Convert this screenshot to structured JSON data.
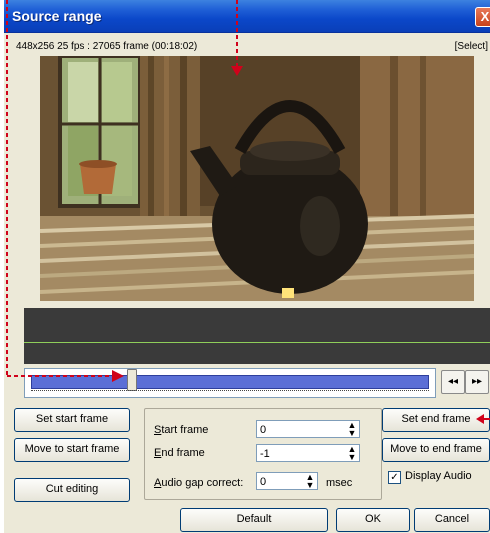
{
  "window": {
    "title": "Source range",
    "close_glyph": "X",
    "info": "448x256 25 fps : 27065 frame (00:18:02)",
    "select_label": "[Select]"
  },
  "seek": {
    "rewind_glyph": "◂◂",
    "forward_glyph": "▸▸",
    "position_fraction": 0.24
  },
  "left_buttons": {
    "set_start": "Set start frame",
    "move_start": "Move to start frame",
    "cut_editing": "Cut editing"
  },
  "fields": {
    "start_label_u": "S",
    "start_label_rest": "tart frame",
    "start_value": "0",
    "end_label_u": "E",
    "end_label_rest": "nd frame",
    "end_value": "-1",
    "gap_label_u": "A",
    "gap_label_rest": "udio gap correct:",
    "gap_value": "0",
    "gap_unit": "msec"
  },
  "right_buttons": {
    "set_end": "Set end frame",
    "move_end": "Move to end frame",
    "display_audio": "Display Audio",
    "display_audio_checked": true
  },
  "bottom_buttons": {
    "default": "Default",
    "ok": "OK",
    "cancel": "Cancel"
  },
  "colors": {
    "title_bar": "#0b47c9",
    "annotation": "#d0021b",
    "seek_track": "#5b6fd6",
    "audio_bg": "#3a3a3a"
  }
}
